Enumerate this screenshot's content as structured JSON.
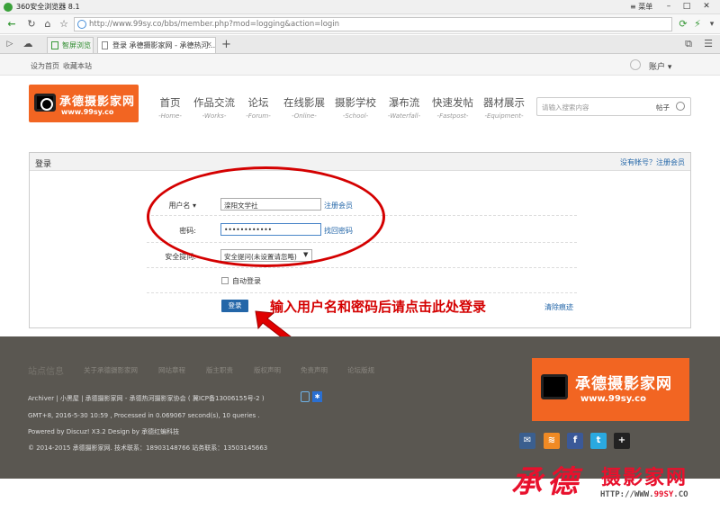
{
  "browser": {
    "title": "360安全浏览器 8.1",
    "menu_label": "菜单",
    "url": "http://www.99sy.co/bbs/member.php?mod=logging&action=login",
    "tabs": [
      {
        "label": "智屏浏览"
      },
      {
        "label": "登录 承德摄影家网 - 承德热河..."
      }
    ]
  },
  "site_top": {
    "set_home": "设为首页",
    "bookmark": "收藏本站",
    "account": "账户"
  },
  "header": {
    "logo_name": "承德摄影家网",
    "logo_url": "www.99sy.co",
    "nav": [
      {
        "cn": "首页",
        "en": "-Home-"
      },
      {
        "cn": "作品交流",
        "en": "-Works-"
      },
      {
        "cn": "论坛",
        "en": "-Forum-"
      },
      {
        "cn": "在线影展",
        "en": "-Online-"
      },
      {
        "cn": "摄影学校",
        "en": "-School-"
      },
      {
        "cn": "瀑布流",
        "en": "-Waterfall-"
      },
      {
        "cn": "快速发帖",
        "en": "-Fastpost-"
      },
      {
        "cn": "器材展示",
        "en": "-Equipment-"
      }
    ],
    "search_placeholder": "请输入搜索内容",
    "search_type": "帖子"
  },
  "login": {
    "title": "登录",
    "no_account": "没有帐号？注册会员",
    "username_label": "用户名",
    "username_value": "滦阳文学社",
    "register_link": "注册会员",
    "password_label": "密码:",
    "password_value": "••••••••••••",
    "forgot_link": "找回密码",
    "security_label": "安全提问:",
    "security_value": "安全提问(未设置请忽略)",
    "auto_login": "自动登录",
    "login_button": "登录",
    "clear_trace": "清除痕迹"
  },
  "annotation": {
    "note": "输入用户名和密码后请点击此处登录"
  },
  "footer": {
    "links": [
      "站点信息",
      "关于承德摄影家网",
      "网站章程",
      "版主职责",
      "版权声明",
      "免责声明",
      "论坛版规"
    ],
    "line1": "Archiver | 小黑屋 | 承德摄影家网 - 承德热河摄影家协会 ( 冀ICP备13006155号-2 )",
    "line2": "GMT+8, 2016-5-30 10:59 , Processed in 0.069067 second(s), 10 queries .",
    "line3": "Powered by Discuz! X3.2 Design by 承德红蝙科技",
    "line4": "© 2014-2015 承德摄影家网. 技术联系：18903148766 站务联系：13503145663",
    "logo_name": "承德摄影家网",
    "logo_url": "www.99sy.co"
  },
  "watermark": {
    "script": "承德",
    "name": "摄影家网",
    "url_prefix": "HTTP://WWW.",
    "url_domain": "99SY",
    "url_suffix": ".CO"
  }
}
